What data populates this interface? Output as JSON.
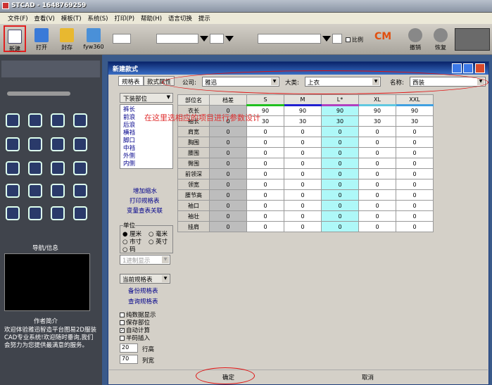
{
  "app": {
    "title": "STCAD - 1648769259"
  },
  "menu": [
    "文件(F)",
    "查看(V)",
    "模板(T)",
    "系统(S)",
    "打印(P)",
    "帮助(H)",
    "语言切换",
    "提示"
  ],
  "toolbar": {
    "new": "新建",
    "open": "打开",
    "save": "封存",
    "home": "fyw360",
    "ratio": "比例",
    "undo": "撤销",
    "redo": "恢复",
    "cm": "CM"
  },
  "left": {
    "nav_title": "导航/信息",
    "author_title": "作者简介",
    "author_text": "欢迎体验雅迅智造平台图易2D服装CAD专业系统!欢迎随时垂询,我们会努力为您提供最满意的服务。"
  },
  "dialog": {
    "title": "新建款式",
    "tabs": [
      "规格表",
      "款式属性"
    ],
    "company_label": "公司:",
    "company_value": "雅迅",
    "category_label": "大类:",
    "category_value": "上衣",
    "name_label": "名称:",
    "name_value": "西装",
    "part_dropdown": "下装部位",
    "part_list": [
      "裤长",
      "前浪",
      "后浪",
      "横裆",
      "脚口",
      "中裆",
      "外侧",
      "内侧"
    ],
    "actions": [
      "增加缩水",
      "打印规格表",
      "变量查表关联"
    ],
    "unit_title": "单位",
    "units": [
      "厘米",
      "毫米",
      "市寸",
      "英寸",
      "码"
    ],
    "unit_selected": "厘米",
    "precision_placeholder": "1进制显示",
    "current_table": "当前规格表",
    "table_actions": [
      "备份规格表",
      "查询规格表"
    ],
    "options": [
      {
        "label": "纯数据显示",
        "checked": false
      },
      {
        "label": "保存部位",
        "checked": false
      },
      {
        "label": "自动计算",
        "checked": true
      },
      {
        "label": "半码插入",
        "checked": false
      }
    ],
    "rows_value": "20",
    "rows_label": "行高",
    "cols_value": "70",
    "cols_label": "列宽",
    "annotation": "在这里选相应的项目进行参数设计",
    "ok": "确定",
    "cancel": "取消"
  },
  "grid": {
    "headers": [
      "部位名",
      "档差",
      "S",
      "M",
      "L*",
      "XL",
      "XXL"
    ],
    "header_colors": [
      "",
      "",
      "#20c020",
      "#2020d0",
      "#b040c0",
      "#60c8e0",
      "#40a0e0"
    ],
    "rows": [
      [
        "衣长",
        "0",
        "90",
        "90",
        "90",
        "90",
        "90"
      ],
      [
        "袖长",
        "0",
        "30",
        "30",
        "30",
        "30",
        "30"
      ],
      [
        "肩宽",
        "0",
        "0",
        "0",
        "0",
        "0",
        "0"
      ],
      [
        "胸围",
        "0",
        "0",
        "0",
        "0",
        "0",
        "0"
      ],
      [
        "腰围",
        "0",
        "0",
        "0",
        "0",
        "0",
        "0"
      ],
      [
        "臀围",
        "0",
        "0",
        "0",
        "0",
        "0",
        "0"
      ],
      [
        "前领深",
        "0",
        "0",
        "0",
        "0",
        "0",
        "0"
      ],
      [
        "领宽",
        "0",
        "0",
        "0",
        "0",
        "0",
        "0"
      ],
      [
        "腰节高",
        "0",
        "0",
        "0",
        "0",
        "0",
        "0"
      ],
      [
        "袖口",
        "0",
        "0",
        "0",
        "0",
        "0",
        "0"
      ],
      [
        "袖壮",
        "0",
        "0",
        "0",
        "0",
        "0",
        "0"
      ],
      [
        "挂肩",
        "0",
        "0",
        "0",
        "0",
        "0",
        "0"
      ]
    ]
  }
}
